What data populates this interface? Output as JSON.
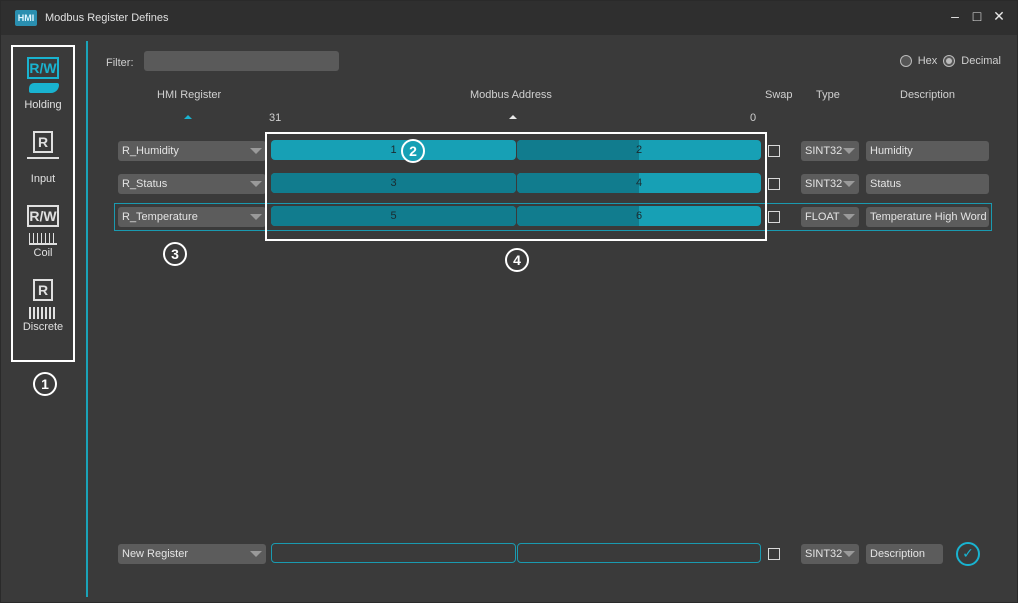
{
  "window": {
    "title": "Modbus Register Defines",
    "icon_label": "HMI",
    "controls": [
      "–",
      "□",
      "✕"
    ]
  },
  "sidebar": {
    "items": [
      {
        "label": "Holding",
        "glyph": "R/W",
        "icon": "holding-register-icon",
        "active": true
      },
      {
        "label": "Input",
        "glyph": "R",
        "icon": "input-register-icon",
        "active": false
      },
      {
        "label": "Coil",
        "glyph": "R/W",
        "icon": "coil-icon",
        "active": false
      },
      {
        "label": "Discrete",
        "glyph": "R",
        "icon": "discrete-input-icon",
        "active": false
      }
    ]
  },
  "callouts": [
    "1",
    "2",
    "3",
    "4"
  ],
  "filter": {
    "label": "Filter:",
    "value": ""
  },
  "format": {
    "hex_label": "Hex",
    "decimal_label": "Decimal",
    "selected": "Decimal"
  },
  "columns": {
    "hmi_register": "HMI Register",
    "modbus_address": "Modbus Address",
    "swap": "Swap",
    "type": "Type",
    "description": "Description",
    "bit_high": "31",
    "bit_low": "0"
  },
  "rows": [
    {
      "register": "R_Humidity",
      "addr_high": "1",
      "addr_low": "2",
      "swap": false,
      "type": "SINT32",
      "description": "Humidity"
    },
    {
      "register": "R_Status",
      "addr_high": "3",
      "addr_low": "4",
      "swap": false,
      "type": "SINT32",
      "description": "Status"
    },
    {
      "register": "R_Temperature",
      "addr_high": "5",
      "addr_low": "6",
      "swap": false,
      "type": "FLOAT",
      "description": "Temperature High Word"
    }
  ],
  "new_row": {
    "register": "New Register",
    "addr_high": "",
    "addr_low": "",
    "swap": false,
    "type": "SINT32",
    "description": "Description"
  },
  "colors": {
    "accent": "#19b3d0",
    "accent_dark": "#117c8e",
    "background": "#3a3a3a",
    "titlebar": "#2f2f2f"
  }
}
